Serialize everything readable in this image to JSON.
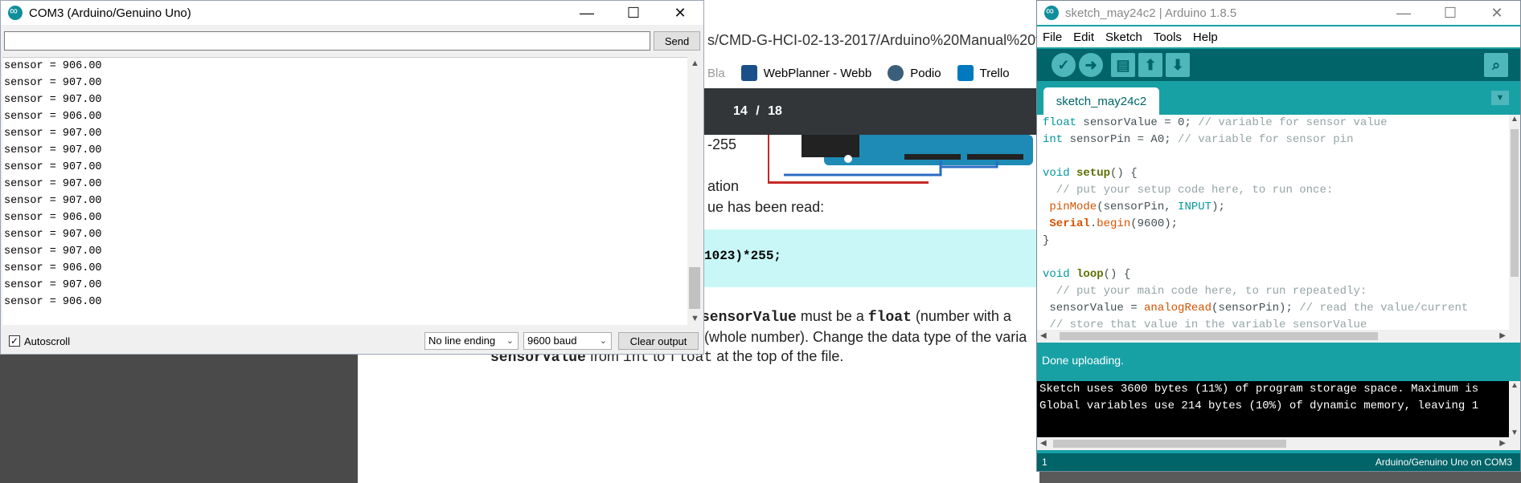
{
  "browser": {
    "url_fragment": "s/CMD-G-HCI-02-13-2017/Arduino%20Manual%20v4",
    "bookmarks": [
      {
        "label": "Bla",
        "icon": "bookmark-icon"
      },
      {
        "label": "WebPlanner - Webb",
        "icon": "webplanner-icon"
      },
      {
        "label": "Podio",
        "icon": "podio-icon"
      },
      {
        "label": "Trello",
        "icon": "trello-icon"
      }
    ],
    "pdf_page_current": "14",
    "pdf_page_sep": "/",
    "pdf_page_total": "18",
    "doc": {
      "range_text": "-255",
      "line_ation": "ation",
      "line_read": "ue has been read:",
      "code_text": "1023)*255;",
      "float_line_a": "sensorValue",
      "float_line_b": " must be a ",
      "float_line_c": "float",
      "float_line_d": " (number with a",
      "whole_line": "(whole number). Change the data type of the varia",
      "last_line_a": "sensorValue",
      "last_line_b": " from ",
      "last_line_c": "int",
      "last_line_d": " to ",
      "last_line_e": "float",
      "last_line_f": " at the top of the file."
    }
  },
  "serial_monitor": {
    "title": "COM3 (Arduino/Genuino Uno)",
    "input_value": "",
    "send_label": "Send",
    "output": [
      "sensor = 906.00",
      "sensor = 907.00",
      "sensor = 907.00",
      "sensor = 906.00",
      "sensor = 907.00",
      "sensor = 907.00",
      "sensor = 907.00",
      "sensor = 907.00",
      "sensor = 907.00",
      "sensor = 906.00",
      "sensor = 907.00",
      "sensor = 907.00",
      "sensor = 906.00",
      "sensor = 907.00",
      "sensor = 906.00"
    ],
    "autoscroll_label": "Autoscroll",
    "autoscroll_checked": true,
    "line_ending": "No line ending",
    "baud": "9600 baud",
    "clear_label": "Clear output"
  },
  "ide": {
    "title": "sketch_may24c2 | Arduino 1.8.5",
    "menu": [
      "File",
      "Edit",
      "Sketch",
      "Tools",
      "Help"
    ],
    "tab": "sketch_may24c2",
    "status": "Done uploading.",
    "console": [
      "Sketch uses 3600 bytes (11%) of program storage space. Maximum is",
      "Global variables use 214 bytes (10%) of dynamic memory, leaving 1"
    ],
    "footer_line": "1",
    "footer_board": "Arduino/Genuino Uno on COM3",
    "code": {
      "l1_kw": "float",
      "l1_rest": " sensorValue = 0; ",
      "l1_cm": "// variable for sensor value",
      "l2_kw": "int",
      "l2_rest": " sensorPin = A0; ",
      "l2_cm": "// variable for sensor pin",
      "l4_kw": "void",
      "l4_fn": "setup",
      "l4_rest": "() {",
      "l5_cm": "  // put your setup code here, to run once:",
      "l6_fn": " pinMode",
      "l6_a": "(sensorPin, ",
      "l6_kw": "INPUT",
      "l6_b": ");",
      "l7_fn": " Serial",
      "l7_a": ".",
      "l7_fn2": "begin",
      "l7_b": "(9600);",
      "l8": "}",
      "l10_kw": "void",
      "l10_fn": "loop",
      "l10_rest": "() {",
      "l11_cm": "  // put your main code here, to run repeatedly:",
      "l12_a": " sensorValue = ",
      "l12_fn": "analogRead",
      "l12_b": "(sensorPin); ",
      "l12_cm": "// read the value/current",
      "l13_cm": " // store that value in the variable sensorValue"
    }
  }
}
